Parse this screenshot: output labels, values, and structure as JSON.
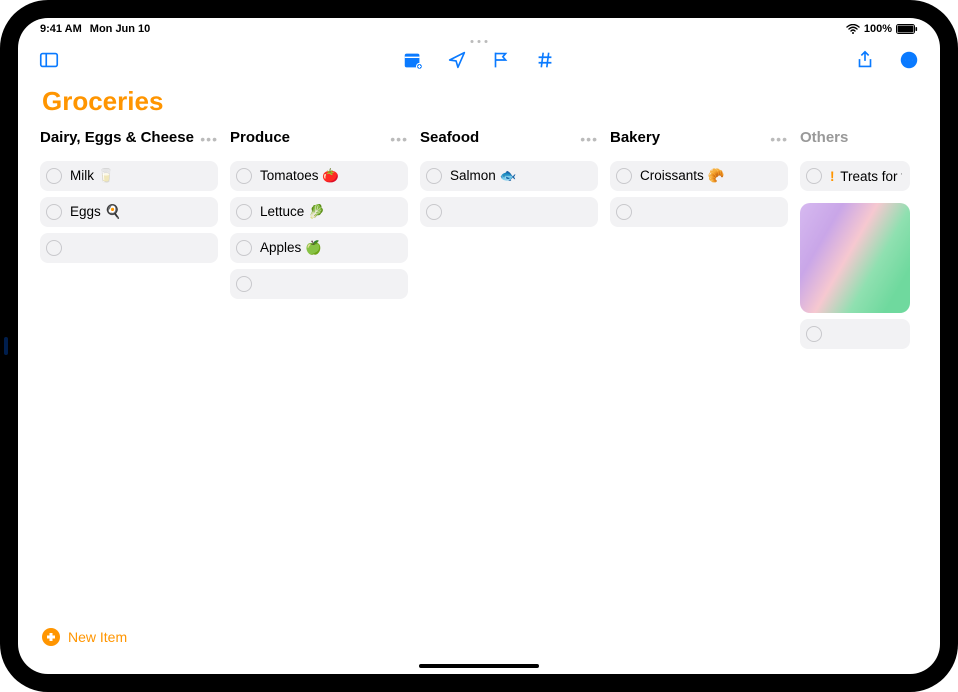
{
  "status": {
    "time": "9:41 AM",
    "date": "Mon Jun 10",
    "battery": "100%"
  },
  "title": "Groceries",
  "newItem": "New Item",
  "columns": [
    {
      "title": "Dairy, Eggs & Cheese",
      "dim": false,
      "items": [
        {
          "label": "Milk 🥛",
          "priority": ""
        },
        {
          "label": "Eggs 🍳",
          "priority": ""
        }
      ],
      "emptySlots": 1,
      "hasImage": false,
      "cutoff": false,
      "showMore": true
    },
    {
      "title": "Produce",
      "dim": false,
      "items": [
        {
          "label": "Tomatoes 🍅",
          "priority": ""
        },
        {
          "label": "Lettuce 🥬",
          "priority": ""
        },
        {
          "label": "Apples 🍏",
          "priority": ""
        }
      ],
      "emptySlots": 1,
      "hasImage": false,
      "cutoff": false,
      "showMore": true
    },
    {
      "title": "Seafood",
      "dim": false,
      "items": [
        {
          "label": "Salmon 🐟",
          "priority": ""
        }
      ],
      "emptySlots": 1,
      "hasImage": false,
      "cutoff": false,
      "showMore": true
    },
    {
      "title": "Bakery",
      "dim": false,
      "items": [
        {
          "label": "Croissants 🥐",
          "priority": ""
        }
      ],
      "emptySlots": 1,
      "hasImage": false,
      "cutoff": false,
      "showMore": true
    },
    {
      "title": "Others",
      "dim": true,
      "items": [
        {
          "label": "Treats for t",
          "priority": "!"
        }
      ],
      "emptySlots": 1,
      "hasImage": true,
      "cutoff": true,
      "showMore": false
    }
  ]
}
